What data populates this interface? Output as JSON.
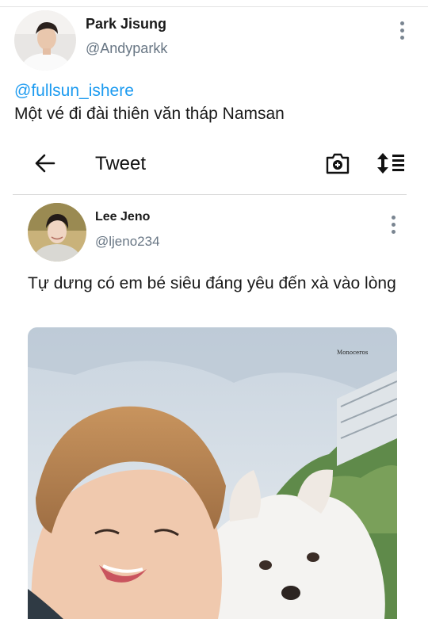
{
  "post": {
    "display_name": "Park Jisung",
    "handle": "@Andyparkk",
    "mention": "@fullsun_ishere",
    "text": "Một vé đi đài thiên văn tháp Namsan"
  },
  "embedded_screen": {
    "header": {
      "title": "Tweet"
    },
    "tweet": {
      "display_name": "Lee Jeno",
      "handle": "@ljeno234",
      "text": "Tự dưng có em bé siêu đáng yêu đến xà vào lòng",
      "photo_watermark": "Monoceros"
    }
  },
  "icons": {
    "back": "arrow-left-icon",
    "camera": "camera-plus-icon",
    "sort": "sort-icon",
    "more": "kebab-menu-icon"
  },
  "colors": {
    "link": "#1d9bf0",
    "handle": "#687684"
  }
}
